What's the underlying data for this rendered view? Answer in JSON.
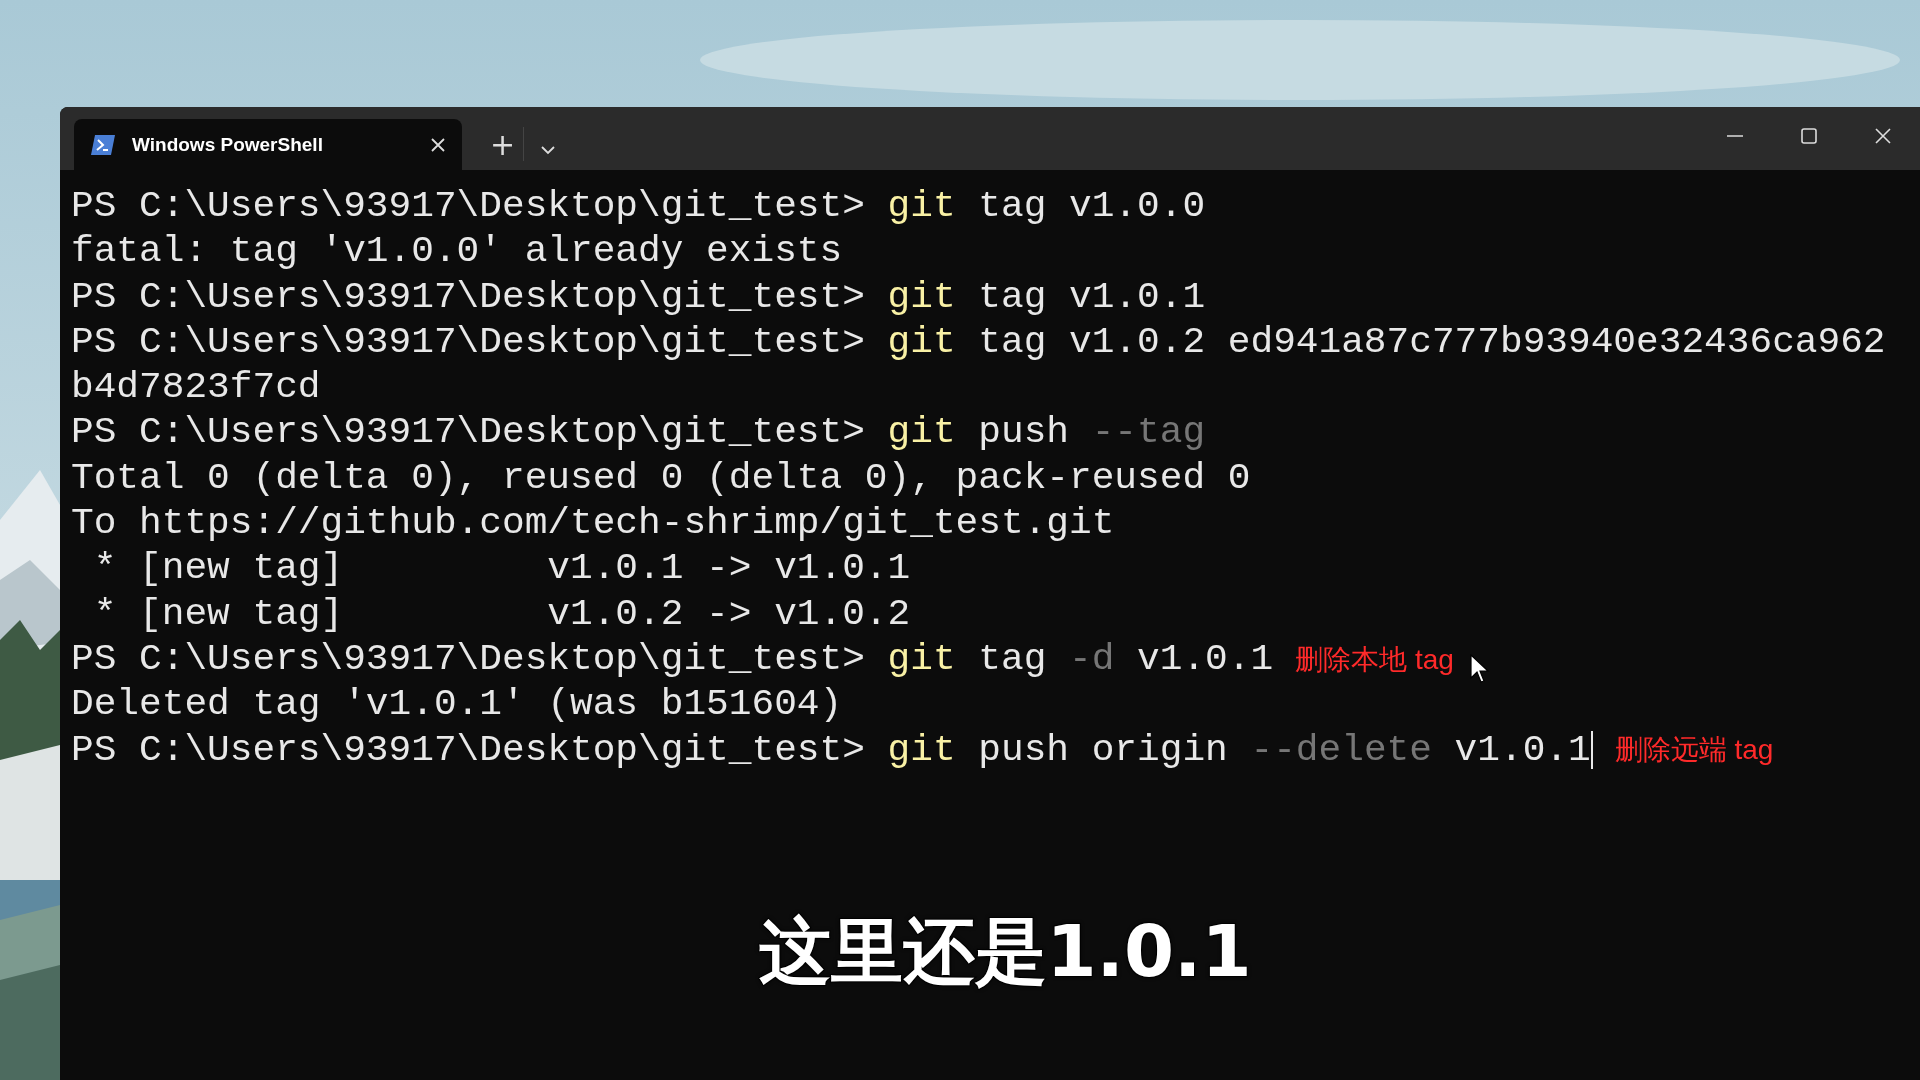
{
  "window": {
    "tab_title": "Windows PowerShell",
    "new_tab": "+"
  },
  "lines": [
    {
      "cursor": false,
      "segments": [
        {
          "kind": "prompt",
          "text": "PS C:\\Users\\93917\\Desktop\\git_test> "
        },
        {
          "kind": "cmd",
          "text": "git"
        },
        {
          "kind": "arg",
          "text": " tag v1.0.0"
        }
      ]
    },
    {
      "cursor": false,
      "segments": [
        {
          "kind": "output",
          "text": "fatal: tag 'v1.0.0' already exists"
        }
      ]
    },
    {
      "cursor": false,
      "segments": [
        {
          "kind": "prompt",
          "text": "PS C:\\Users\\93917\\Desktop\\git_test> "
        },
        {
          "kind": "cmd",
          "text": "git"
        },
        {
          "kind": "arg",
          "text": " tag v1.0.1"
        }
      ]
    },
    {
      "cursor": false,
      "segments": [
        {
          "kind": "prompt",
          "text": "PS C:\\Users\\93917\\Desktop\\git_test> "
        },
        {
          "kind": "cmd",
          "text": "git"
        },
        {
          "kind": "arg",
          "text": " tag v1.0.2 ed941a87c777b93940e32436ca962"
        }
      ]
    },
    {
      "cursor": false,
      "segments": [
        {
          "kind": "arg",
          "text": "b4d7823f7cd"
        }
      ]
    },
    {
      "cursor": false,
      "segments": [
        {
          "kind": "prompt",
          "text": "PS C:\\Users\\93917\\Desktop\\git_test> "
        },
        {
          "kind": "cmd",
          "text": "git"
        },
        {
          "kind": "arg",
          "text": " push "
        },
        {
          "kind": "flag",
          "text": "--tag"
        }
      ]
    },
    {
      "cursor": false,
      "segments": [
        {
          "kind": "output",
          "text": "Total 0 (delta 0), reused 0 (delta 0), pack-reused 0"
        }
      ]
    },
    {
      "cursor": false,
      "segments": [
        {
          "kind": "output",
          "text": "To https://github.com/tech-shrimp/git_test.git"
        }
      ]
    },
    {
      "cursor": false,
      "segments": [
        {
          "kind": "output",
          "text": " * [new tag]         v1.0.1 -> v1.0.1"
        }
      ]
    },
    {
      "cursor": false,
      "segments": [
        {
          "kind": "output",
          "text": " * [new tag]         v1.0.2 -> v1.0.2"
        }
      ]
    },
    {
      "cursor": false,
      "note": "删除本地 tag",
      "segments": [
        {
          "kind": "prompt",
          "text": "PS C:\\Users\\93917\\Desktop\\git_test> "
        },
        {
          "kind": "cmd",
          "text": "git"
        },
        {
          "kind": "arg",
          "text": " tag "
        },
        {
          "kind": "flag",
          "text": "-d"
        },
        {
          "kind": "arg",
          "text": " v1.0.1"
        }
      ]
    },
    {
      "cursor": false,
      "segments": [
        {
          "kind": "output",
          "text": "Deleted tag 'v1.0.1' (was b151604)"
        }
      ]
    },
    {
      "cursor": true,
      "note": "删除远端 tag",
      "segments": [
        {
          "kind": "prompt",
          "text": "PS C:\\Users\\93917\\Desktop\\git_test> "
        },
        {
          "kind": "cmd",
          "text": "git"
        },
        {
          "kind": "arg",
          "text": " push origin "
        },
        {
          "kind": "flag",
          "text": "--delete"
        },
        {
          "kind": "arg",
          "text": " v1.0.1"
        }
      ]
    }
  ],
  "subtitle": "这里还是1.0.1"
}
